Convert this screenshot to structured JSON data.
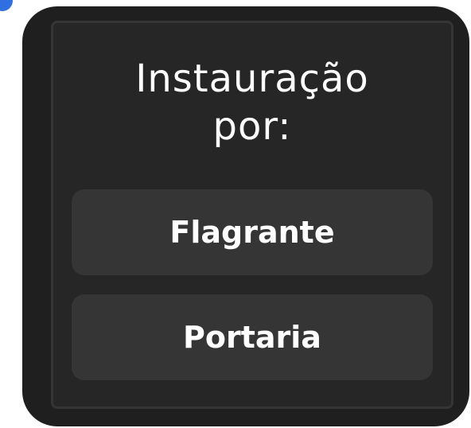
{
  "dialog": {
    "title_line1": "Instauração",
    "title_line2": "por:"
  },
  "options": [
    {
      "label": "Flagrante"
    },
    {
      "label": "Portaria"
    }
  ],
  "colors": {
    "panel_background": "#1f1f1f",
    "inner_background": "#262626",
    "button_background": "#353535",
    "text": "#ffffff",
    "accent_dot": "#2f6fe0"
  }
}
